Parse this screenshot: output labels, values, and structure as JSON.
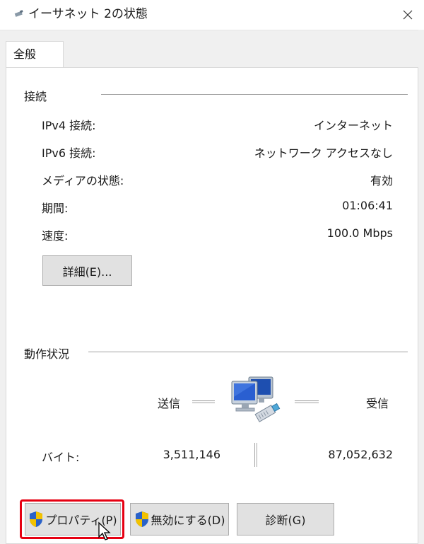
{
  "window": {
    "title": "イーサネット 2の状態",
    "icon": "network-adapter-icon",
    "close_glyph": "✕"
  },
  "tabs": [
    {
      "label": "全般",
      "selected": true
    }
  ],
  "connection": {
    "section_title": "接続",
    "rows": [
      {
        "label": "IPv4 接続:",
        "value": "インターネット"
      },
      {
        "label": "IPv6 接続:",
        "value": "ネットワーク アクセスなし"
      },
      {
        "label": "メディアの状態:",
        "value": "有効"
      },
      {
        "label": "期間:",
        "value": "01:06:41"
      },
      {
        "label": "速度:",
        "value": "100.0 Mbps"
      }
    ],
    "details_button": "詳細(E)..."
  },
  "activity": {
    "section_title": "動作状況",
    "sent_label": "送信",
    "received_label": "受信",
    "bytes_label": "バイト:",
    "bytes_sent": "3,511,146",
    "bytes_received": "87,052,632",
    "icon": "network-computers-icon"
  },
  "buttons": {
    "properties": "プロパティ(P)",
    "disable": "無効にする(D)",
    "diagnose": "診断(G)"
  },
  "colors": {
    "highlight": "#e60012",
    "shield_blue": "#2a62c9",
    "shield_yellow": "#f2c200"
  }
}
